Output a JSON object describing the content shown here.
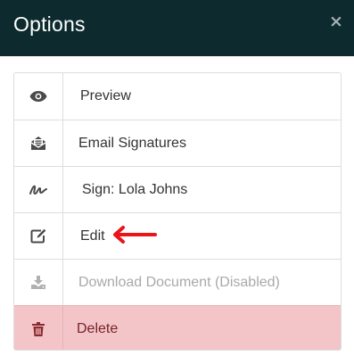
{
  "dialog": {
    "title": "Options",
    "close_symbol": "×"
  },
  "options": [
    {
      "label": "Preview",
      "icon": "eye-icon",
      "state": "enabled"
    },
    {
      "label": "Email Signatures",
      "icon": "envelope-open-icon",
      "state": "enabled"
    },
    {
      "label": "Sign: Lola Johns",
      "icon": "signature-icon",
      "state": "enabled"
    },
    {
      "label": "Edit",
      "icon": "edit-icon",
      "state": "enabled"
    },
    {
      "label": "Download Document (Disabled)",
      "icon": "download-icon",
      "state": "disabled"
    },
    {
      "label": "Delete",
      "icon": "trash-icon",
      "state": "danger"
    }
  ],
  "annotation": {
    "type": "arrow",
    "points_to": "Edit",
    "color": "#e8151b"
  },
  "colors": {
    "header_bg": "#0d2b2e",
    "icon": "#4a4a4a",
    "disabled": "#a9a9a9",
    "danger_bg": "#f3c5c9",
    "danger_text": "#7a2226",
    "arrow": "#e8151b"
  }
}
